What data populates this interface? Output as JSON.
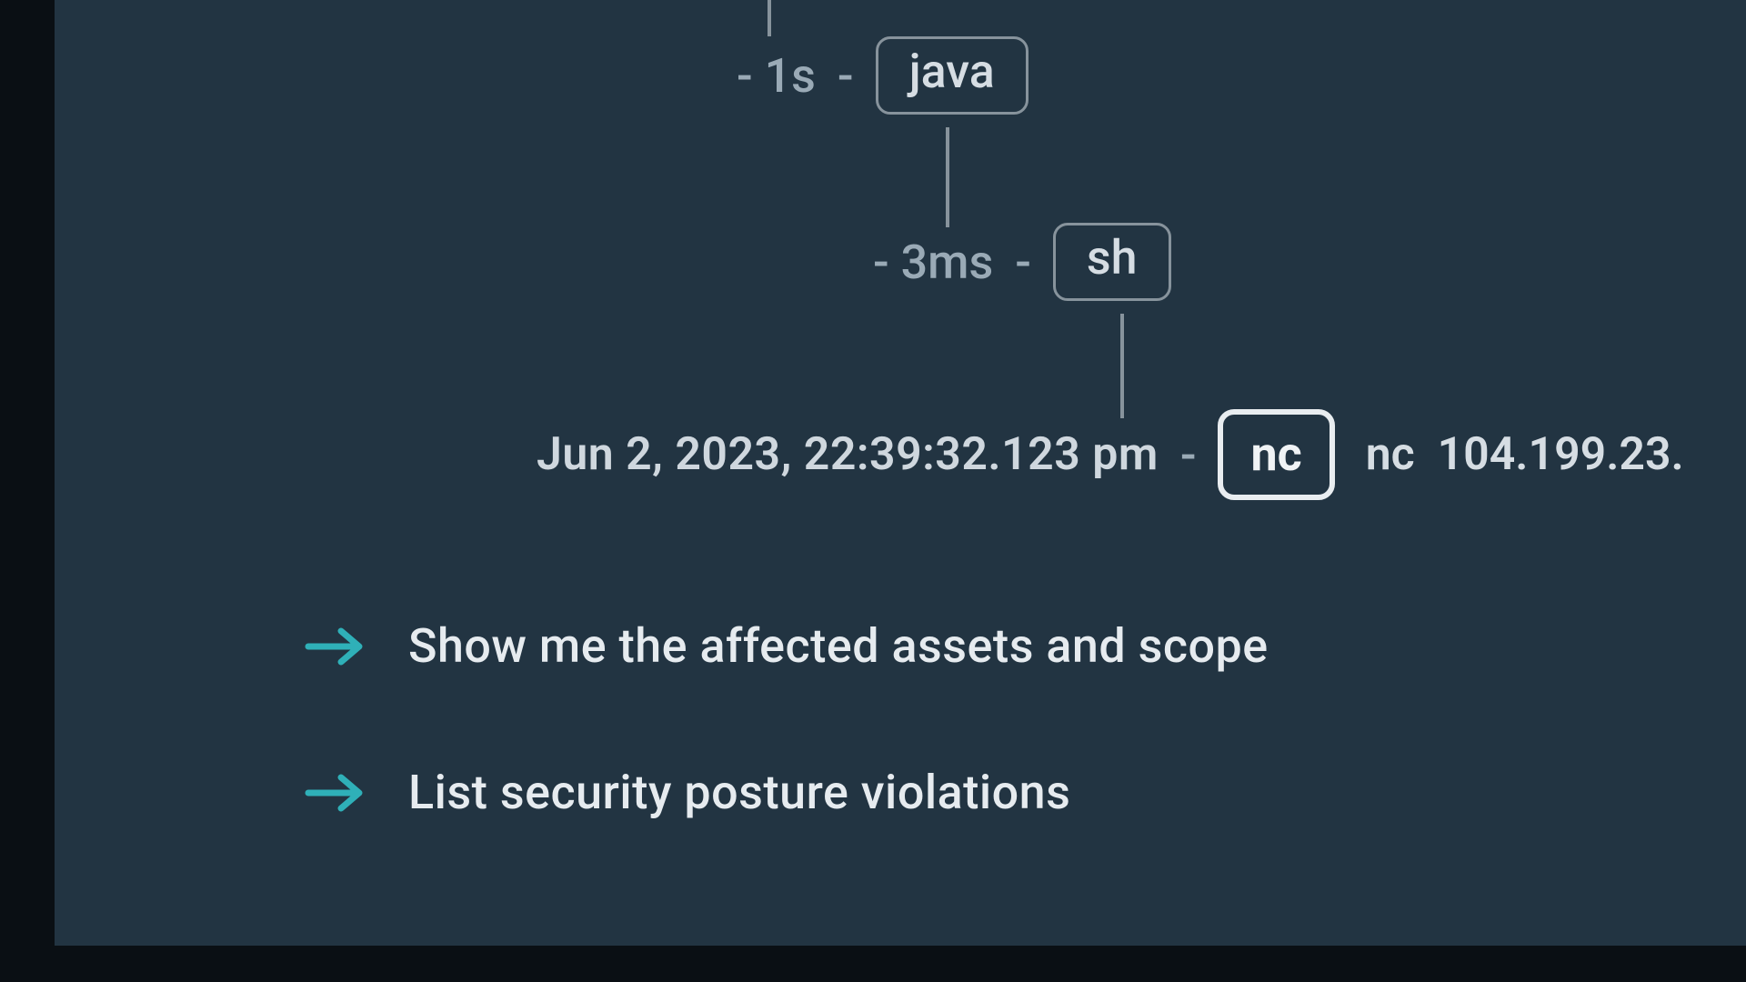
{
  "tree": {
    "java": {
      "delay": "- 1s",
      "name": "java"
    },
    "sh": {
      "delay": "- 3ms",
      "name": "sh"
    },
    "nc": {
      "timestamp": "Jun 2, 2023, 22:39:32.123 pm",
      "name": "nc",
      "cmd_prefix": "nc",
      "cmd_args": "104.199.23."
    }
  },
  "suggestions": [
    {
      "label": "Show me the affected assets and scope"
    },
    {
      "label": "List security posture violations"
    }
  ],
  "colors": {
    "accent": "#2fb0b8"
  }
}
